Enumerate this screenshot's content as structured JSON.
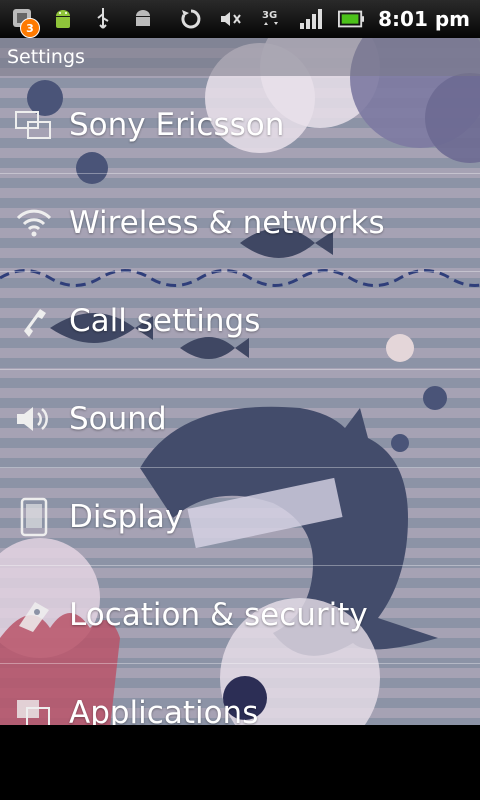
{
  "status_bar": {
    "notification_count": "3",
    "icons": [
      "notification-icon",
      "android-icon",
      "usb-icon",
      "debug-icon",
      "sync-icon",
      "mute-icon",
      "3g-icon",
      "signal-icon",
      "battery-icon"
    ],
    "time": "8:01 pm"
  },
  "title": "Settings",
  "items": [
    {
      "label": "Sony Ericsson",
      "icon": "sony-ericsson-icon"
    },
    {
      "label": "Wireless & networks",
      "icon": "wifi-icon"
    },
    {
      "label": "Call settings",
      "icon": "phone-icon"
    },
    {
      "label": "Sound",
      "icon": "speaker-icon"
    },
    {
      "label": "Display",
      "icon": "display-icon"
    },
    {
      "label": "Location & security",
      "icon": "location-icon"
    },
    {
      "label": "Applications",
      "icon": "applications-icon"
    }
  ],
  "colors": {
    "accent_badge": "#ff7a00",
    "stripe_dark": "#8c93a6",
    "stripe_light": "#a6a2b4",
    "denim": "#3f4763"
  }
}
